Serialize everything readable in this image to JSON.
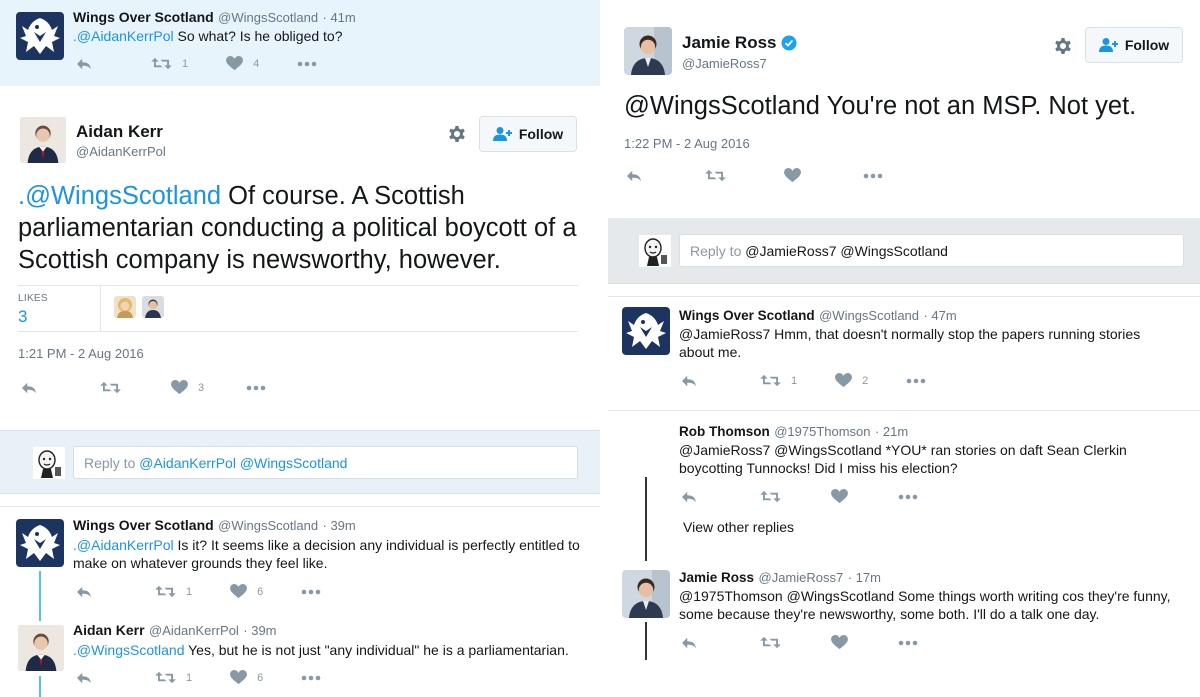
{
  "left": {
    "tweet1": {
      "name": "Wings Over Scotland",
      "handle": "@WingsScotland",
      "time": "· 41m",
      "mention": ".@AidanKerrPol",
      "text": " So what? Is he obliged to?",
      "retweets": "1",
      "likes": "4"
    },
    "main": {
      "name": "Aidan Kerr",
      "handle": "@AidanKerrPol",
      "follow_label": "Follow",
      "mention": ".@WingsScotland",
      "text": " Of course. A Scottish parliamentarian conducting a political boycott of a Scottish company is newsworthy, however.",
      "likes_label": "LIKES",
      "likes_count": "3",
      "timestamp": "1:21 PM - 2 Aug 2016",
      "like_action_count": "3"
    },
    "reply_box": {
      "placeholder_prefix": "Reply to ",
      "placeholder_mentions": "@AidanKerrPol @WingsScotland"
    },
    "reply1": {
      "name": "Wings Over Scotland",
      "handle": "@WingsScotland",
      "time": "· 39m",
      "mention": ".@AidanKerrPol",
      "text": " Is it? It seems like a decision any individual is perfectly entitled to make on whatever grounds they feel like.",
      "retweets": "1",
      "likes": "6"
    },
    "reply2": {
      "name": "Aidan Kerr",
      "handle": "@AidanKerrPol",
      "time": "· 39m",
      "mention": ".@WingsScotland",
      "text": " Yes, but he is not just \"any individual\" he is a parliamentarian.",
      "retweets": "1",
      "likes": "6"
    }
  },
  "right": {
    "main": {
      "name": "Jamie Ross",
      "handle": "@JamieRoss7",
      "follow_label": "Follow",
      "text": "@WingsScotland You're not an MSP. Not yet.",
      "timestamp": "1:22 PM - 2 Aug 2016"
    },
    "reply_box": {
      "placeholder_prefix": "Reply to ",
      "placeholder_mentions": "@JamieRoss7 @WingsScotland"
    },
    "reply1": {
      "name": "Wings Over Scotland",
      "handle": "@WingsScotland",
      "time": "· 47m",
      "text": "@JamieRoss7 Hmm, that doesn't normally stop the papers running stories about me.",
      "retweets": "1",
      "likes": "2"
    },
    "reply2": {
      "name": "Rob Thomson",
      "handle": "@1975Thomson",
      "time": "· 21m",
      "text": "@JamieRoss7 @WingsScotland *YOU* ran stories on daft Sean Clerkin boycotting Tunnocks! Did I miss his election?",
      "view_other": "View other replies"
    },
    "reply3": {
      "name": "Jamie Ross",
      "handle": "@JamieRoss7",
      "time": "· 17m",
      "text": "@1975Thomson @WingsScotland Some things worth writing cos they're funny, some because they're newsworthy, some both. I'll do a talk one day."
    }
  },
  "colors": {
    "link": "#1b95e0",
    "muted": "#657786",
    "icon": "#8899a6",
    "highlight": "#e8f4fb",
    "reply_bg_left": "#e8f1f8",
    "reply_bg_right": "#e6e9ec",
    "thread_left": "#4fc3e8",
    "thread_right": "#333333",
    "verified": "#1da1f2"
  }
}
